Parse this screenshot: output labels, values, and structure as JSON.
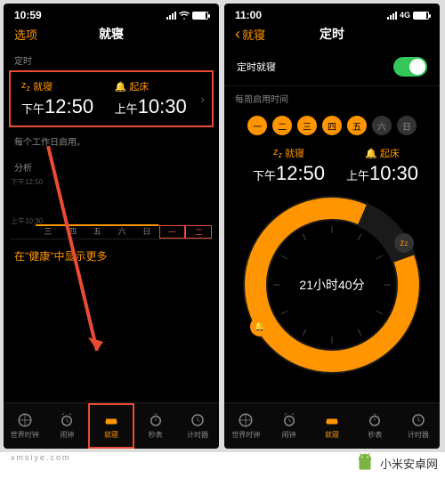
{
  "left": {
    "status_time": "10:59",
    "nav_left": "选项",
    "nav_title": "就寝",
    "sec_timer": "定时",
    "bed_label": "就寝",
    "bed_prefix": "下午",
    "bed_time": "12:50",
    "wake_label": "起床",
    "wake_prefix": "上午",
    "wake_time": "10:30",
    "note": "每个工作日启用。",
    "sec_analysis": "分析",
    "chart_y_top": "下午12:50",
    "chart_y_bot": "上午10:30",
    "chart_days": [
      "三",
      "四",
      "五",
      "六",
      "日",
      "一",
      "二"
    ],
    "more": "在\"健康\"中显示更多",
    "tabs": [
      "世界时钟",
      "闹钟",
      "就寝",
      "秒表",
      "计时器"
    ]
  },
  "right": {
    "status_time": "11:00",
    "status_net": "4G",
    "back": "就寝",
    "nav_title": "定时",
    "row_label": "定时就寝",
    "sec_week": "每周启用时间",
    "days": [
      {
        "t": "一",
        "on": true
      },
      {
        "t": "二",
        "on": true
      },
      {
        "t": "三",
        "on": true
      },
      {
        "t": "四",
        "on": true
      },
      {
        "t": "五",
        "on": true
      },
      {
        "t": "六",
        "on": false
      },
      {
        "t": "日",
        "on": false
      }
    ],
    "bed_label": "就寝",
    "bed_prefix": "下午",
    "bed_time": "12:50",
    "wake_label": "起床",
    "wake_prefix": "上午",
    "wake_time": "10:30",
    "duration": "21小时40分",
    "tabs": [
      "世界时钟",
      "闹钟",
      "就寝",
      "秒表",
      "计时器"
    ]
  },
  "watermark": "小米安卓网",
  "xm": "xmsiye.com"
}
